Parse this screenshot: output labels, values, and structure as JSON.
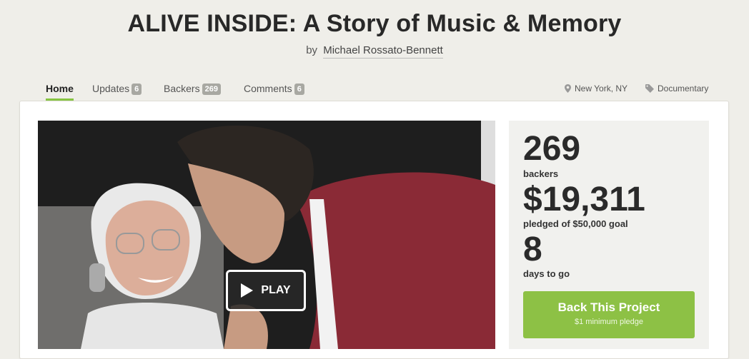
{
  "project": {
    "title": "ALIVE INSIDE: A Story of Music & Memory",
    "by_label": "by",
    "author": "Michael Rossato-Bennett"
  },
  "tabs": [
    {
      "label": "Home",
      "count": null,
      "active": true
    },
    {
      "label": "Updates",
      "count": "6",
      "active": false
    },
    {
      "label": "Backers",
      "count": "269",
      "active": false
    },
    {
      "label": "Comments",
      "count": "6",
      "active": false
    }
  ],
  "meta": {
    "location": "New York, NY",
    "category": "Documentary",
    "location_icon": "map-pin-icon",
    "category_icon": "tag-icon"
  },
  "video": {
    "play_label": "PLAY",
    "play_icon": "play-icon"
  },
  "stats": {
    "backers_value": "269",
    "backers_label": "backers",
    "pledged_value": "$19,311",
    "pledged_label": "pledged of $50,000 goal",
    "days_value": "8",
    "days_label": "days to go"
  },
  "cta": {
    "label": "Back This Project",
    "sublabel": "$1 minimum pledge"
  },
  "colors": {
    "accent_green": "#8dc145",
    "background": "#efeee9",
    "count_badge": "#a8a8a2"
  }
}
